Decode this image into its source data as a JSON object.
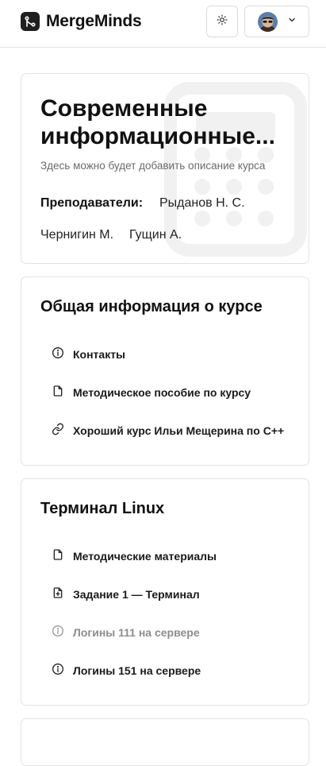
{
  "header": {
    "brand": "MergeMinds",
    "icons": {
      "logo": "git-merge-icon",
      "theme": "sun-icon",
      "avatar": "user-avatar",
      "menu": "chevron-down-icon"
    }
  },
  "course": {
    "title": "Современные информационные...",
    "description": "Здесь можно будет добавить описание курса",
    "teachers_label": "Преподаватели:",
    "teachers": [
      "Рыданов Н. С.",
      "Чернигин М.",
      "Гущин А."
    ],
    "background_icon": "calculator-icon"
  },
  "sections": [
    {
      "title": "Общая информация о курсе",
      "items": [
        {
          "label": "Контакты",
          "icon": "info-icon"
        },
        {
          "label": "Методическое пособие по курсу",
          "icon": "file-icon"
        },
        {
          "label": "Хороший курс Ильи Мещерина по C++",
          "icon": "link-icon"
        }
      ]
    },
    {
      "title": "Терминал Linux",
      "items": [
        {
          "label": "Методические материалы",
          "icon": "file-icon"
        },
        {
          "label": "Задание 1 — Терминал",
          "icon": "file-plus-icon"
        },
        {
          "label": "Логины 111 на сервере",
          "icon": "info-icon",
          "state": "disabled"
        },
        {
          "label": "Логины 151 на сервере",
          "icon": "info-icon"
        }
      ]
    }
  ]
}
